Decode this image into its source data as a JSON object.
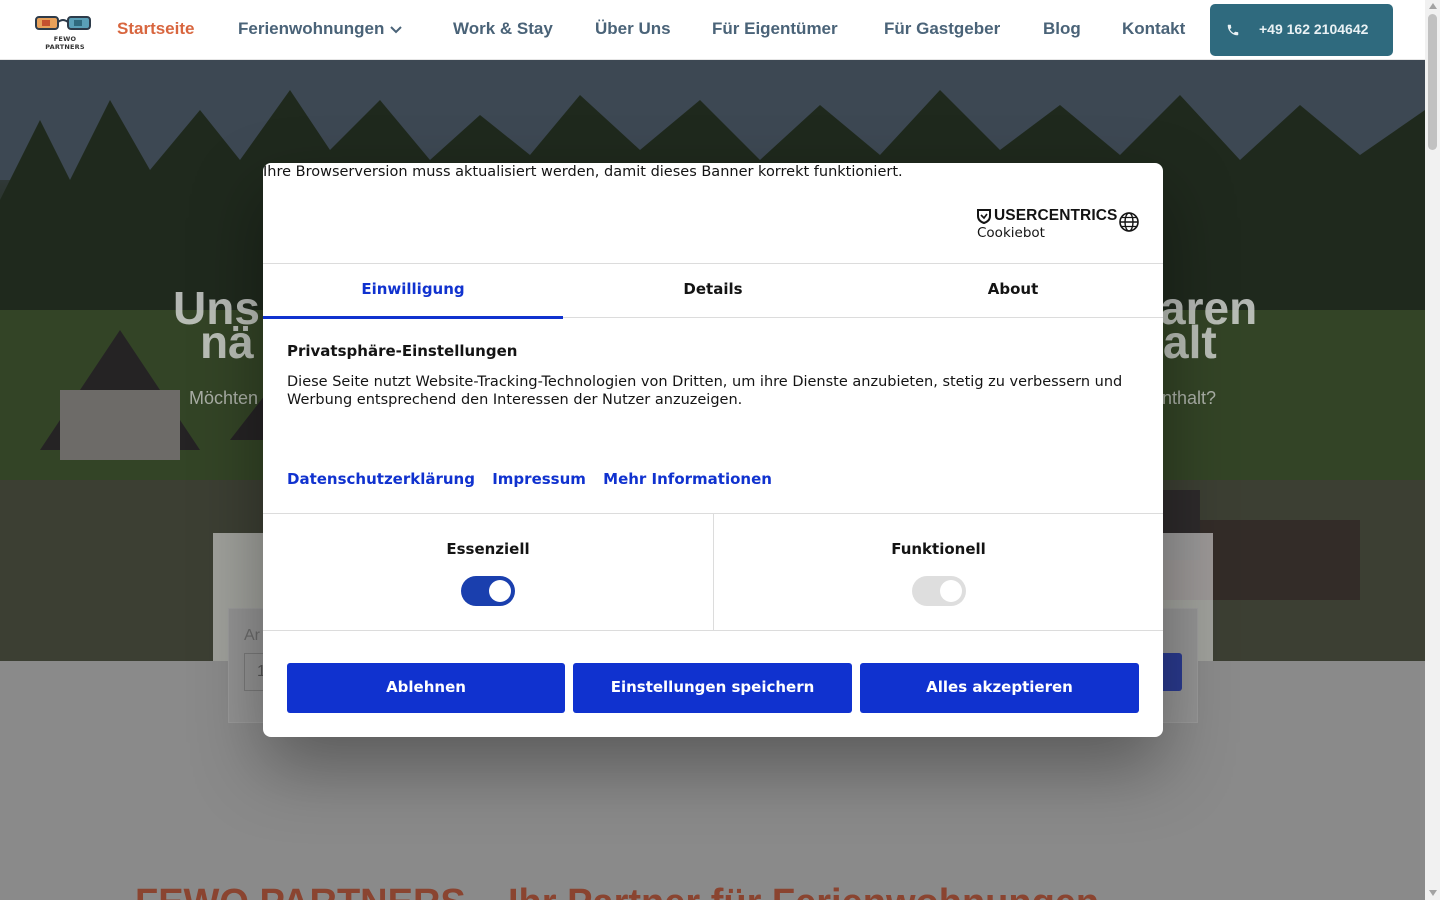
{
  "header": {
    "logo_text": "FEWO PARTNERS",
    "nav": [
      {
        "label": "Startseite",
        "active": true
      },
      {
        "label": "Ferienwohnungen",
        "has_dropdown": true
      },
      {
        "label": "Work & Stay"
      },
      {
        "label": "Über Uns"
      },
      {
        "label": "Für Eigentümer"
      },
      {
        "label": "Für Gastgeber"
      },
      {
        "label": "Blog"
      },
      {
        "label": "Kontakt"
      }
    ],
    "phone": "+49 162 2104642",
    "icons": {
      "phone": "phone-icon",
      "dropdown": "chevron-down-icon"
    },
    "colors": {
      "active": "#d8663f",
      "nav": "#4a6378",
      "phone_button": "#2f6a7e"
    }
  },
  "hero": {
    "title_line1_left": "Uns",
    "title_line1_right": "aren",
    "title_line2_left": "nä",
    "title_line2_right": "alt",
    "subtitle_left": "Möchten",
    "subtitle_right": "enthalt?",
    "search_label_fragment": "Ar",
    "search_field_fragment": "1"
  },
  "section_heading_fragment": "FEWO PARTNERS – Ihr Partner für Ferienwohnungen",
  "cookie_dialog": {
    "browser_warning": "Ihre Browserversion muss aktualisiert werden, damit dieses Banner korrekt funktioniert.",
    "brand": "USERCENTRICS",
    "brand_sub": "Cookiebot",
    "language_icon": "globe-icon",
    "tabs": [
      {
        "label": "Einwilligung",
        "active": true
      },
      {
        "label": "Details"
      },
      {
        "label": "About"
      }
    ],
    "privacy_title": "Privatsphäre-Einstellungen",
    "privacy_text": "Diese Seite nutzt Website-Tracking-Technologien von Dritten, um ihre Dienste anzubieten, stetig zu verbessern und Werbung entsprechend den Interessen der Nutzer anzuzeigen.",
    "links": [
      "Datenschutzerklärung",
      "Impressum",
      "Mehr Informationen"
    ],
    "consents": [
      {
        "label": "Essenziell",
        "enabled": true,
        "disabled": true
      },
      {
        "label": "Funktionell",
        "enabled": true,
        "disabled": true
      }
    ],
    "buttons": {
      "deny": "Ablehnen",
      "save": "Einstellungen speichern",
      "accept_all": "Alles akzeptieren"
    },
    "colors": {
      "accent": "#1032cf",
      "toggle_on": "#1a3fae"
    }
  }
}
